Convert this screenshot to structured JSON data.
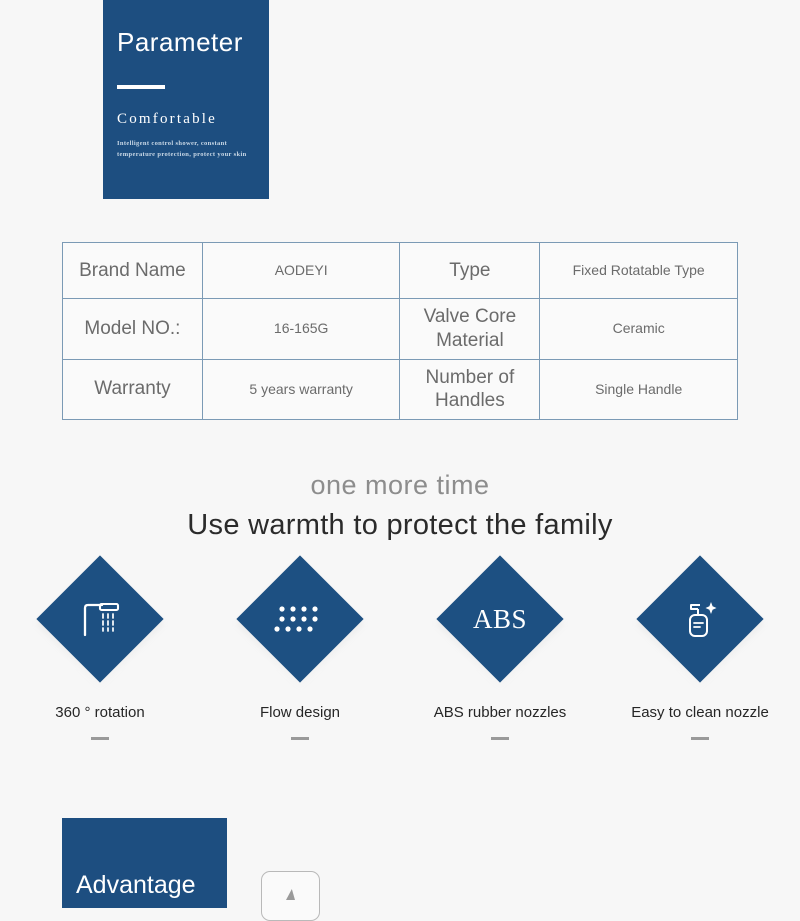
{
  "banner": {
    "title": "Parameter",
    "subtitle": "Comfortable",
    "description": "Intelligent control shower, constant temperature protection, protect your skin"
  },
  "spec_table": {
    "rows": [
      {
        "label": "Brand Name",
        "value": "AODEYI",
        "label2": "Type",
        "value2": "Fixed Rotatable Type"
      },
      {
        "label": "Model NO.:",
        "value": "16-165G",
        "label2": "Valve Core Material",
        "value2": "Ceramic"
      },
      {
        "label": "Warranty",
        "value": "5 years warranty",
        "label2": "Number of Handles",
        "value2": "Single Handle"
      }
    ]
  },
  "headline": {
    "small": "one more time",
    "big": "Use warmth to protect the family"
  },
  "features": [
    {
      "label": "360 ° rotation",
      "icon": "shower-head-icon"
    },
    {
      "label": "Flow design",
      "icon": "nozzle-dot-grid-icon"
    },
    {
      "label": "ABS rubber nozzles",
      "icon": "abs-text-icon",
      "icon_text": "ABS"
    },
    {
      "label": "Easy to clean nozzle",
      "icon": "soap-dispenser-icon"
    }
  ],
  "advantage": {
    "title": "Advantage"
  },
  "colors": {
    "brand_blue": "#1d4e80",
    "diamond_blue": "#1d5082",
    "background": "#f7f7f7",
    "table_border": "#7b9ab5",
    "table_text": "#6b6b6b"
  }
}
